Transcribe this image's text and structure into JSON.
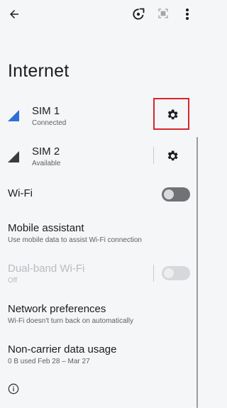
{
  "page": {
    "title": "Internet"
  },
  "toolbar": {
    "back_icon": "arrow-left-icon",
    "refresh_icon": "refresh-icon",
    "qr_icon": "qr-scan-icon",
    "more_icon": "more-vert-icon"
  },
  "sims": [
    {
      "label": "SIM 1",
      "status": "Connected",
      "signal_color": "#2f6fd6"
    },
    {
      "label": "SIM 2",
      "status": "Available",
      "signal_color": "#3a3b3e"
    }
  ],
  "wifi": {
    "label": "Wi-Fi"
  },
  "mobile_assistant": {
    "label": "Mobile assistant",
    "summary": "Use mobile data to assist Wi-Fi connection"
  },
  "dual_band": {
    "label": "Dual-band Wi-Fi",
    "summary": "Off"
  },
  "network_prefs": {
    "label": "Network preferences",
    "summary": "Wi-Fi doesn't turn back on automatically"
  },
  "noncarrier": {
    "label": "Non-carrier data usage",
    "summary": "0 B used Feb 28 – Mar 27"
  },
  "colors": {
    "highlight": "#d7262b",
    "toggle_off": "#707276"
  }
}
